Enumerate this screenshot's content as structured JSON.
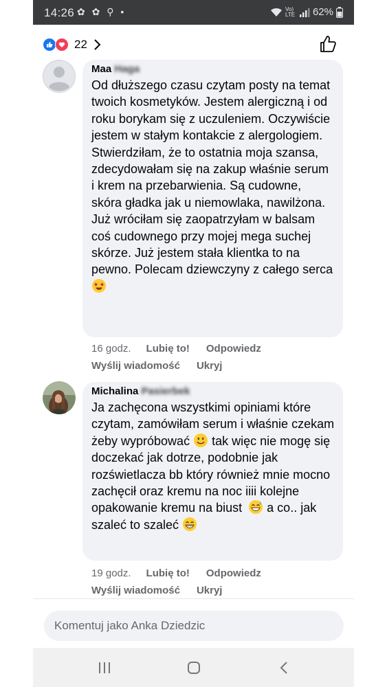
{
  "statusbar": {
    "time": "14:26",
    "left_icons": "✿ ✿ ⚲ •",
    "network": "Vo) LTE",
    "battery": "62%"
  },
  "header": {
    "reaction_count": "22",
    "reactions": [
      "like",
      "love"
    ]
  },
  "comments": [
    {
      "author_visible": "Maa",
      "author_blurred": "Haga",
      "text": "Od dłuższego czasu czytam posty na temat twoich kosmetyków. Jestem alergiczną i od roku borykam się z uczuleniem. Oczywiście jestem w stałym kontakcie z alergologiem. Stwierdziłam, że to ostatnia moja szansa, zdecydowałam się na zakup właśnie serum i krem na przebarwienia. Są cudowne, skóra gładka jak u niemowlaka, nawilżona. Już wróciłam się zaopatrzyłam w balsam coś cudownego przy mojej mega suchej skórze. Już jestem stała klientka to na pewno. Polecam dziewczyny z całego serca",
      "time": "16 godz.",
      "like": "Lubię to!",
      "reply": "Odpowiedz",
      "message": "Wyślij wiadomość",
      "hide": "Ukryj"
    },
    {
      "author_visible": "Michalina",
      "author_blurred": "Pasierbek",
      "text_1": "Ja zachęcona wszystkimi opiniami które czytam, zamówiłam serum i właśnie czekam żeby wypróbować",
      "text_2": "tak więc nie mogę się doczekać jak dotrze, podobnie jak rozświetlacza bb który również mnie mocno zachęcił oraz kremu na noc iiii kolejne opakowanie kremu na biust",
      "text_3": "a co.. jak szaleć to szaleć",
      "time": "19 godz.",
      "like": "Lubię to!",
      "reply": "Odpowiedz",
      "message": "Wyślij wiadomość",
      "hide": "Ukryj"
    }
  ],
  "composer": {
    "placeholder": "Komentuj jako Anka Dziedzic"
  },
  "colors": {
    "like_blue": "#1877f2",
    "love_red": "#f33e58",
    "bubble_bg": "#f0f2f5",
    "meta_gray": "#65676b"
  }
}
